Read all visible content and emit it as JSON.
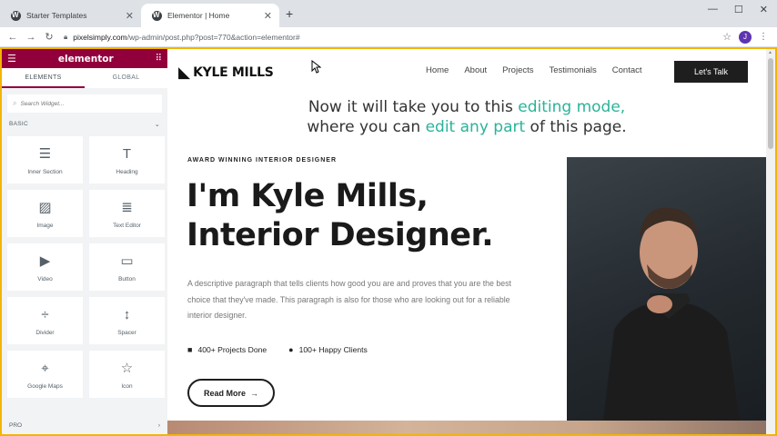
{
  "browser": {
    "tabs": [
      {
        "title": "Starter Templates",
        "active": false
      },
      {
        "title": "Elementor | Home",
        "active": true
      }
    ],
    "new_tab": "+",
    "window_controls": [
      "—",
      "☐",
      "✕"
    ],
    "url_domain": "pixelsimply.com",
    "url_path": "/wp-admin/post.php?post=770&action=elementor#",
    "profile_initial": "J"
  },
  "panel": {
    "logo": "elementor",
    "tabs": [
      "ELEMENTS",
      "GLOBAL"
    ],
    "search_placeholder": "Search Widget...",
    "section_basic": "BASIC",
    "section_pro": "PRO",
    "widgets": [
      {
        "label": "Inner Section",
        "icon": "inner-section-icon",
        "glyph": "☰"
      },
      {
        "label": "Heading",
        "icon": "heading-icon",
        "glyph": "T"
      },
      {
        "label": "Image",
        "icon": "image-icon",
        "glyph": "▨"
      },
      {
        "label": "Text Editor",
        "icon": "text-editor-icon",
        "glyph": "≣"
      },
      {
        "label": "Video",
        "icon": "video-icon",
        "glyph": "▶"
      },
      {
        "label": "Button",
        "icon": "button-icon",
        "glyph": "▭"
      },
      {
        "label": "Divider",
        "icon": "divider-icon",
        "glyph": "÷"
      },
      {
        "label": "Spacer",
        "icon": "spacer-icon",
        "glyph": "↕"
      },
      {
        "label": "Google Maps",
        "icon": "map-icon",
        "glyph": "⌖"
      },
      {
        "label": "Icon",
        "icon": "star-icon",
        "glyph": "☆"
      }
    ]
  },
  "site": {
    "brand": "KYLE MILLS",
    "nav": [
      "Home",
      "About",
      "Projects",
      "Testimonials",
      "Contact"
    ],
    "cta": "Let's Talk",
    "overlay": {
      "line1_a": "Now it will take you to this ",
      "line1_b": "editing mode,",
      "line2_a": "where you can ",
      "line2_b": "edit any part",
      "line2_c": " of this page."
    },
    "eyebrow": "AWARD WINNING INTERIOR DESIGNER",
    "headline": "I'm Kyle Mills, Interior Designer.",
    "description": "A descriptive paragraph that tells clients how good you are and proves that you are the best choice that they've made. This paragraph is also for those who are looking out for a reliable interior designer.",
    "stats": [
      {
        "label": "400+ Projects Done",
        "icon": "briefcase-icon"
      },
      {
        "label": "100+ Happy Clients",
        "icon": "user-icon"
      }
    ],
    "read_more": "Read More",
    "accent_color": "#2bb39a",
    "elementor_color": "#92003b"
  }
}
